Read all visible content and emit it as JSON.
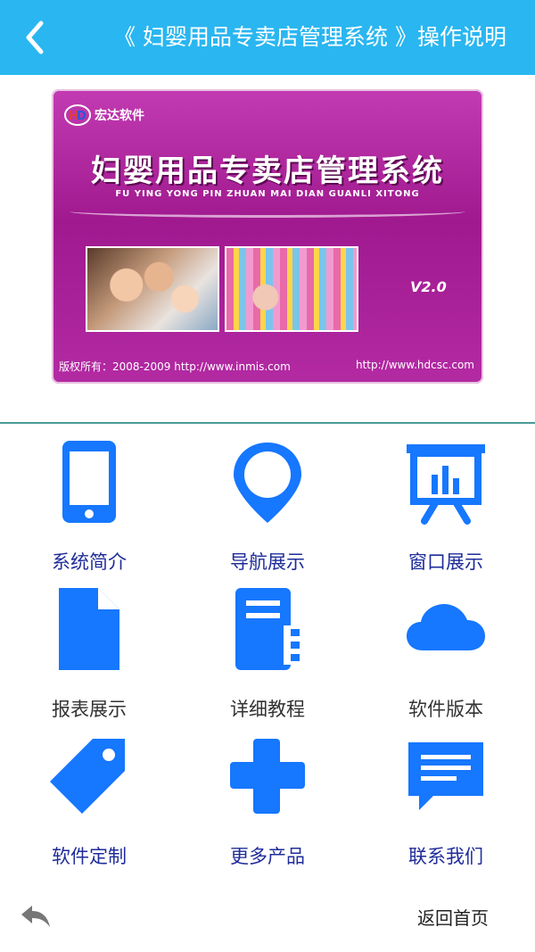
{
  "header": {
    "title": "《 妇婴用品专卖店管理系统 》操作说明",
    "background": "#2ab6f0",
    "back_icon": "chevron-left-icon"
  },
  "banner": {
    "logo_text": "宏达软件",
    "title": "妇婴用品专卖店管理系统",
    "subtitle": "FU YING YONG PIN ZHUAN MAI DIAN GUANLI XITONG",
    "version": "V2.0",
    "copyright": "版权所有：2008-2009  http://www.inmis.com",
    "site": "http://www.hdcsc.com",
    "color": "#b0259f"
  },
  "grid": {
    "accent_color": "#1677ff",
    "items": [
      {
        "label": "系统简介",
        "icon": "phone-icon"
      },
      {
        "label": "导航展示",
        "icon": "map-pin-icon"
      },
      {
        "label": "窗口展示",
        "icon": "presentation-chart-icon"
      },
      {
        "label": "报表展示",
        "icon": "document-icon"
      },
      {
        "label": "详细教程",
        "icon": "notebook-icon"
      },
      {
        "label": "软件版本",
        "icon": "cloud-icon"
      },
      {
        "label": "软件定制",
        "icon": "tag-icon"
      },
      {
        "label": "更多产品",
        "icon": "plus-icon"
      },
      {
        "label": "联系我们",
        "icon": "message-icon"
      }
    ]
  },
  "footer": {
    "back_icon": "reply-arrow-icon",
    "home_label": "返回首页"
  }
}
